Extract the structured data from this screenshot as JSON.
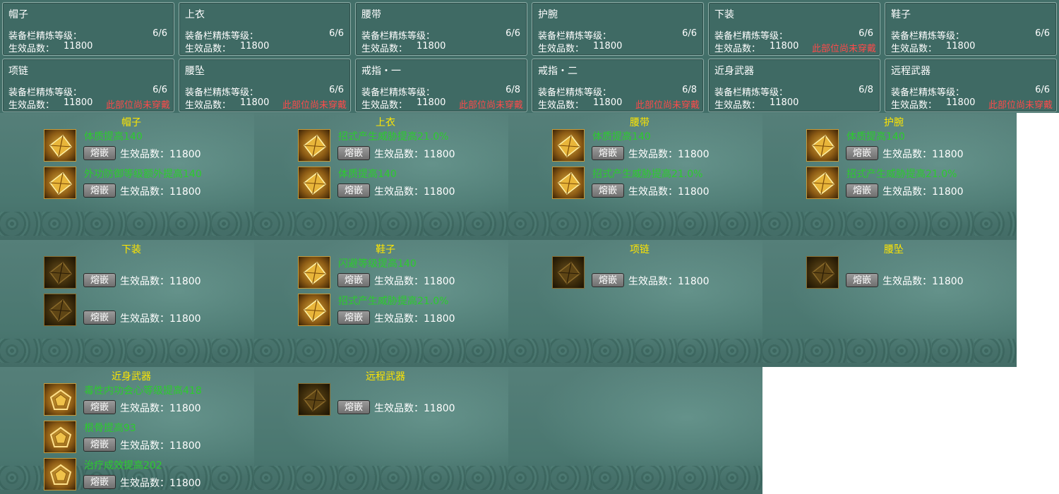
{
  "cards": [
    {
      "title": "帽子",
      "level_label": "装备栏精炼等级：",
      "level": "6/6",
      "count_label": "生效品数：",
      "count": "11800",
      "warning": ""
    },
    {
      "title": "上衣",
      "level_label": "装备栏精炼等级：",
      "level": "6/6",
      "count_label": "生效品数：",
      "count": "11800",
      "warning": ""
    },
    {
      "title": "腰带",
      "level_label": "装备栏精炼等级：",
      "level": "6/6",
      "count_label": "生效品数：",
      "count": "11800",
      "warning": ""
    },
    {
      "title": "护腕",
      "level_label": "装备栏精炼等级：",
      "level": "6/6",
      "count_label": "生效品数：",
      "count": "11800",
      "warning": ""
    },
    {
      "title": "下装",
      "level_label": "装备栏精炼等级：",
      "level": "6/6",
      "count_label": "生效品数：",
      "count": "11800",
      "warning": "此部位尚未穿戴"
    },
    {
      "title": "鞋子",
      "level_label": "装备栏精炼等级：",
      "level": "6/6",
      "count_label": "生效品数：",
      "count": "11800",
      "warning": ""
    },
    {
      "title": "项链",
      "level_label": "装备栏精炼等级：",
      "level": "6/6",
      "count_label": "生效品数：",
      "count": "11800",
      "warning": "此部位尚未穿戴"
    },
    {
      "title": "腰坠",
      "level_label": "装备栏精炼等级：",
      "level": "6/6",
      "count_label": "生效品数：",
      "count": "11800",
      "warning": "此部位尚未穿戴"
    },
    {
      "title": "戒指・一",
      "level_label": "装备栏精炼等级：",
      "level": "6/8",
      "count_label": "生效品数：",
      "count": "11800",
      "warning": "此部位尚未穿戴"
    },
    {
      "title": "戒指・二",
      "level_label": "装备栏精炼等级：",
      "level": "6/8",
      "count_label": "生效品数：",
      "count": "11800",
      "warning": "此部位尚未穿戴"
    },
    {
      "title": "近身武器",
      "level_label": "装备栏精炼等级：",
      "level": "6/8",
      "count_label": "生效品数：",
      "count": "11800",
      "warning": ""
    },
    {
      "title": "远程武器",
      "level_label": "装备栏精炼等级：",
      "level": "6/6",
      "count_label": "生效品数：",
      "count": "11800",
      "warning": "此部位尚未穿戴"
    }
  ],
  "panels": [
    {
      "title": "帽子",
      "slots": [
        {
          "attr": "体质提高140",
          "button": "熔嵌",
          "effect": "生效品数：11800",
          "gem": "gold-kite-gem-icon",
          "active": true
        },
        {
          "attr": "外功防御等级额外提高140",
          "button": "熔嵌",
          "effect": "生效品数：11800",
          "gem": "gold-kite-gem-icon",
          "active": true
        }
      ]
    },
    {
      "title": "上衣",
      "slots": [
        {
          "attr": "招式产生威胁提高21.0%",
          "button": "熔嵌",
          "effect": "生效品数：11800",
          "gem": "gold-kite-gem-icon",
          "active": true
        },
        {
          "attr": "体质提高140",
          "button": "熔嵌",
          "effect": "生效品数：11800",
          "gem": "gold-kite-gem-icon",
          "active": true
        }
      ]
    },
    {
      "title": "腰带",
      "slots": [
        {
          "attr": "体质提高140",
          "button": "熔嵌",
          "effect": "生效品数：11800",
          "gem": "gold-kite-gem-icon",
          "active": true
        },
        {
          "attr": "招式产生威胁提高21.0%",
          "button": "熔嵌",
          "effect": "生效品数：11800",
          "gem": "gold-kite-gem-icon",
          "active": true
        }
      ]
    },
    {
      "title": "护腕",
      "slots": [
        {
          "attr": "体质提高140",
          "button": "熔嵌",
          "effect": "生效品数：11800",
          "gem": "gold-kite-gem-icon",
          "active": true
        },
        {
          "attr": "招式产生威胁提高21.0%",
          "button": "熔嵌",
          "effect": "生效品数：11800",
          "gem": "gold-kite-gem-icon",
          "active": true
        }
      ]
    },
    {
      "title": "下装",
      "slots": [
        {
          "attr": "",
          "button": "熔嵌",
          "effect": "生效品数：11800",
          "gem": "dim-kite-gem-icon",
          "active": false
        },
        {
          "attr": "",
          "button": "熔嵌",
          "effect": "生效品数：11800",
          "gem": "dim-kite-gem-icon",
          "active": false
        }
      ]
    },
    {
      "title": "鞋子",
      "slots": [
        {
          "attr": "闪避等级提高140",
          "button": "熔嵌",
          "effect": "生效品数：11800",
          "gem": "gold-kite-gem-icon",
          "active": true
        },
        {
          "attr": "招式产生威胁提高21.0%",
          "button": "熔嵌",
          "effect": "生效品数：11800",
          "gem": "gold-kite-gem-icon",
          "active": true
        }
      ]
    },
    {
      "title": "项链",
      "slots": [
        {
          "attr": "",
          "button": "熔嵌",
          "effect": "生效品数：11800",
          "gem": "dim-kite-gem-icon",
          "active": false
        }
      ]
    },
    {
      "title": "腰坠",
      "slots": [
        {
          "attr": "",
          "button": "熔嵌",
          "effect": "生效品数：11800",
          "gem": "dim-kite-gem-icon",
          "active": false
        }
      ]
    },
    {
      "title": "近身武器",
      "slots": [
        {
          "attr": "毒性内功会心等级提高418",
          "button": "熔嵌",
          "effect": "生效品数：11800",
          "gem": "gold-pentagon-gem-icon",
          "active": true
        },
        {
          "attr": "根骨提高93",
          "button": "熔嵌",
          "effect": "生效品数：11800",
          "gem": "gold-pentagon-gem-icon",
          "active": true
        },
        {
          "attr": "治疗成效提高202",
          "button": "熔嵌",
          "effect": "生效品数：11800",
          "gem": "gold-pentagon-gem-icon",
          "active": true
        }
      ]
    },
    {
      "title": "远程武器",
      "slots": [
        {
          "attr": "",
          "button": "熔嵌",
          "effect": "生效品数：11800",
          "gem": "dim-kite-gem-icon",
          "active": false
        }
      ]
    }
  ]
}
